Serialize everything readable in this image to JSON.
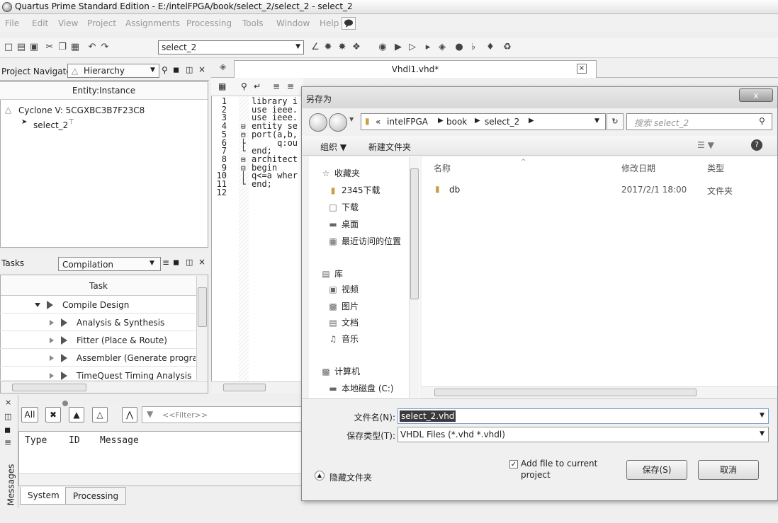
{
  "window": {
    "title": "Quartus Prime Standard Edition - E:/intelFPGA/book/select_2/select_2 - select_2"
  },
  "menu": [
    "File",
    "Edit",
    "View",
    "Project",
    "Assignments",
    "Processing",
    "Tools",
    "Window",
    "Help"
  ],
  "toolbar": {
    "project_combo": "select_2"
  },
  "navigator": {
    "title": "Project Navigator",
    "view": "Hierarchy",
    "column": "Entity:Instance",
    "device": "Cyclone V: 5CGXBC3B7F23C8",
    "instance": "select_2"
  },
  "tasks": {
    "title": "Tasks",
    "flow": "Compilation",
    "column": "Task",
    "rows": [
      "Compile Design",
      "Analysis & Synthesis",
      "Fitter (Place & Route)",
      "Assembler (Generate programr",
      "TimeQuest Timing Analysis"
    ]
  },
  "editor": {
    "tab": "Vhdl1.vhd*",
    "lines": [
      "library i",
      "use ieee.",
      "use ieee.",
      "entity se",
      "port(a,b,",
      "     q:ou",
      "end;",
      "architect",
      "begin",
      "q<=a wher",
      "end;",
      ""
    ],
    "line_numbers": [
      "1",
      "2",
      "3",
      "4",
      "5",
      "6",
      "7",
      "8",
      "9",
      "10",
      "11",
      "12"
    ]
  },
  "messages": {
    "side_label": "Messages",
    "all_btn": "All",
    "filter_placeholder": "<<Filter>>",
    "columns": [
      "Type",
      "ID",
      "Message"
    ],
    "tabs": [
      "System",
      "Processing"
    ]
  },
  "dialog": {
    "title": "另存为",
    "close": "x",
    "breadcrumb": [
      "«",
      "intelFPGA",
      "book",
      "select_2"
    ],
    "search_placeholder": "搜索 select_2",
    "organize": "组织 ▼",
    "new_folder": "新建文件夹",
    "tree": {
      "favorites": "收藏夹",
      "fav_items": [
        "2345下载",
        "下载",
        "桌面",
        "最近访问的位置"
      ],
      "library": "库",
      "lib_items": [
        "视频",
        "图片",
        "文档",
        "音乐"
      ],
      "computer": "计算机",
      "drive": "本地磁盘 (C:)"
    },
    "columns": {
      "name": "名称",
      "date": "修改日期",
      "type": "类型"
    },
    "files": [
      {
        "name": "db",
        "date": "2017/2/1 18:00",
        "type": "文件夹"
      }
    ],
    "filename_label": "文件名(N):",
    "filename": "select_2.vhd",
    "filetype_label": "保存类型(T):",
    "filetype": "VHDL Files (*.vhd *.vhdl)",
    "add_to_project": "Add file to current project",
    "hide_folders": "隐藏文件夹",
    "save": "保存(S)",
    "cancel": "取消"
  }
}
